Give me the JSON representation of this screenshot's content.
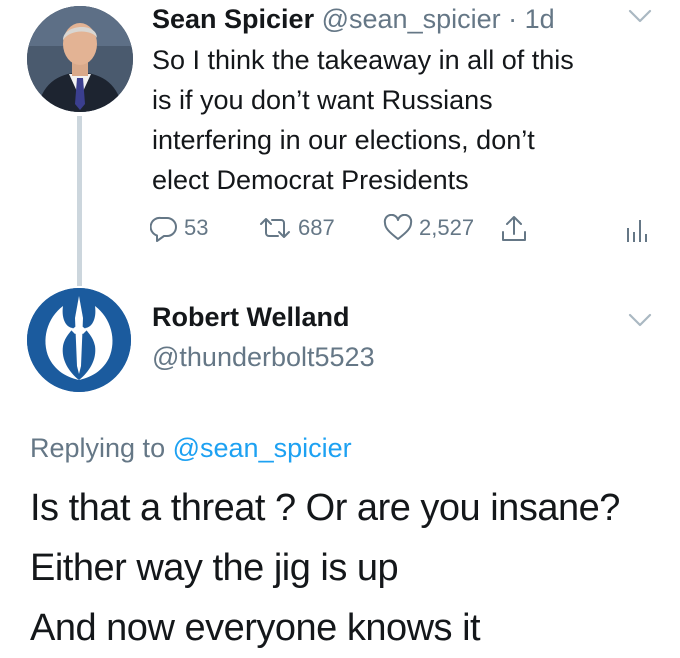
{
  "tweet": {
    "author_name": "Sean Spicier",
    "author_handle": "@sean_spicier",
    "separator": "·",
    "time": "1d",
    "text_lines": [
      "So I think the takeaway in all of this",
      "is if you don’t want Russians",
      "interfering in our elections, don’t",
      "elect Democrat Presidents"
    ],
    "reply_count": "53",
    "retweet_count": "687",
    "like_count": "2,527"
  },
  "reply": {
    "author_name": "Robert Welland",
    "author_handle": "@thunderbolt5523",
    "replying_prefix": "Replying to",
    "replying_to": "@sean_spicier",
    "text_lines": [
      "Is that a threat ? Or are you insane?",
      "Either way the jig is up",
      "And now everyone knows it"
    ]
  },
  "icons": {
    "chevron": "chevron-down-icon",
    "reply": "reply-icon",
    "retweet": "retweet-icon",
    "like": "heart-icon",
    "share": "share-icon",
    "analytics": "analytics-icon"
  },
  "colors": {
    "text": "#14171a",
    "secondary": "#657786",
    "link": "#1da1f2",
    "thread_line": "#ccd6dd",
    "rebel_blue": "#1b5b9e"
  }
}
